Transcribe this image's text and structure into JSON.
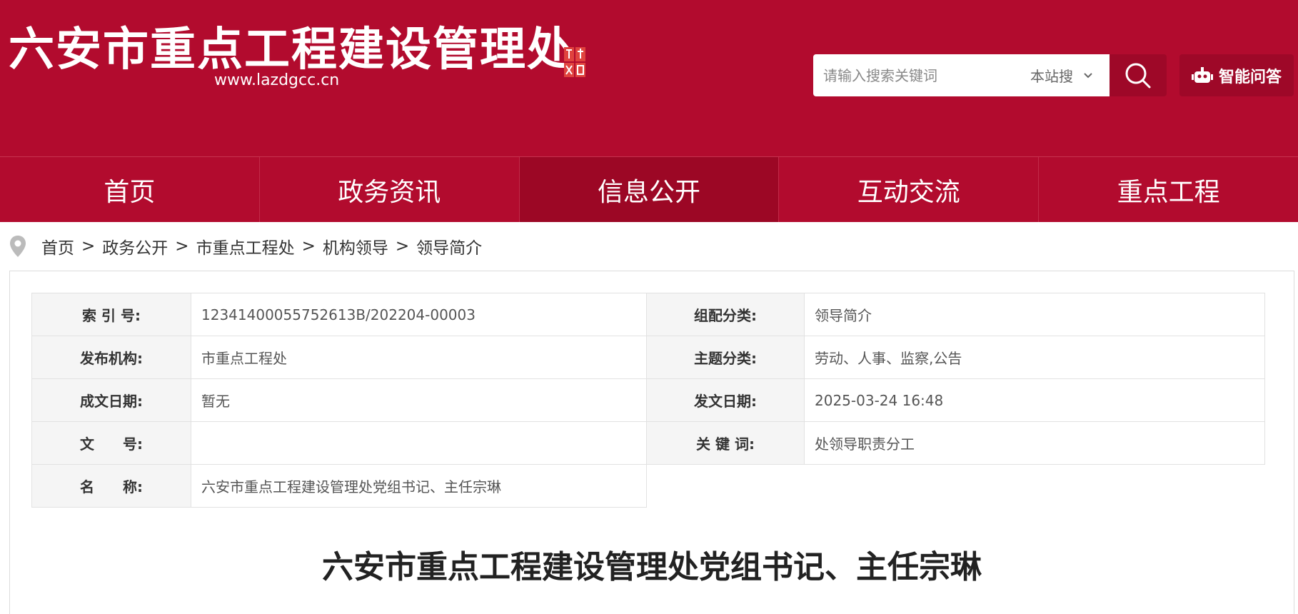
{
  "header": {
    "site_title": "六安市重点工程建设管理处",
    "site_url": "www.lazdgcc.cn",
    "search": {
      "placeholder": "请输入搜索关键词",
      "scope": "本站搜"
    },
    "ai_button": "智能问答",
    "brand_color": "#b20b2e"
  },
  "nav": {
    "items": [
      {
        "label": "首页"
      },
      {
        "label": "政务资讯"
      },
      {
        "label": "信息公开"
      },
      {
        "label": "互动交流"
      },
      {
        "label": "重点工程"
      }
    ],
    "active_index": 2
  },
  "breadcrumb": {
    "items": [
      "首页",
      "政务公开",
      "市重点工程处",
      "机构领导",
      "领导简介"
    ],
    "separator": ">"
  },
  "meta": {
    "index_no_label": "索 引 号:",
    "index_no": "12341400055752613B/202204-00003",
    "category_label": "组配分类:",
    "category": "领导简介",
    "publisher_label": "发布机构:",
    "publisher": "市重点工程处",
    "topic_label": "主题分类:",
    "topic": "劳动、人事、监察,公告",
    "written_date_label": "成文日期:",
    "written_date": "暂无",
    "publish_date_label": "发文日期:",
    "publish_date": "2025-03-24 16:48",
    "doc_no_label": "文　　号:",
    "doc_no": "",
    "keywords_label": "关 键 词:",
    "keywords": "处领导职责分工",
    "name_label": "名　　称:",
    "name": "六安市重点工程建设管理处党组书记、主任宗琳"
  },
  "article": {
    "title": "六安市重点工程建设管理处党组书记、主任宗琳"
  }
}
